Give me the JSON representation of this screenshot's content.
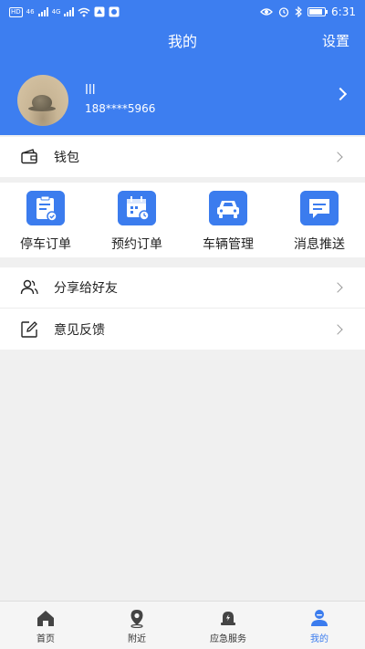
{
  "status_bar": {
    "left_chips": [
      "HD",
      "46",
      "4G"
    ],
    "time": "6:31"
  },
  "header": {
    "title": "我的",
    "settings_label": "设置"
  },
  "profile": {
    "username": "lll",
    "phone": "188****5966"
  },
  "wallet": {
    "label": "钱包"
  },
  "quick_actions": [
    {
      "label": "停车订单",
      "icon": "parking-order-icon"
    },
    {
      "label": "预约订单",
      "icon": "reservation-calendar-icon"
    },
    {
      "label": "车辆管理",
      "icon": "car-icon"
    },
    {
      "label": "消息推送",
      "icon": "message-icon"
    }
  ],
  "menu": [
    {
      "label": "分享给好友",
      "icon": "share-friends-icon"
    },
    {
      "label": "意见反馈",
      "icon": "feedback-edit-icon"
    }
  ],
  "tabbar": {
    "active": "我的",
    "tabs": [
      {
        "label": "首页",
        "icon": "home-icon"
      },
      {
        "label": "附近",
        "icon": "location-pin-icon"
      },
      {
        "label": "应急服务",
        "icon": "emergency-light-icon"
      },
      {
        "label": "我的",
        "icon": "profile-icon"
      }
    ]
  },
  "colors": {
    "brand": "#3d7ef0",
    "icon_blue": "#3b7cee",
    "background": "#f0f0f0"
  }
}
